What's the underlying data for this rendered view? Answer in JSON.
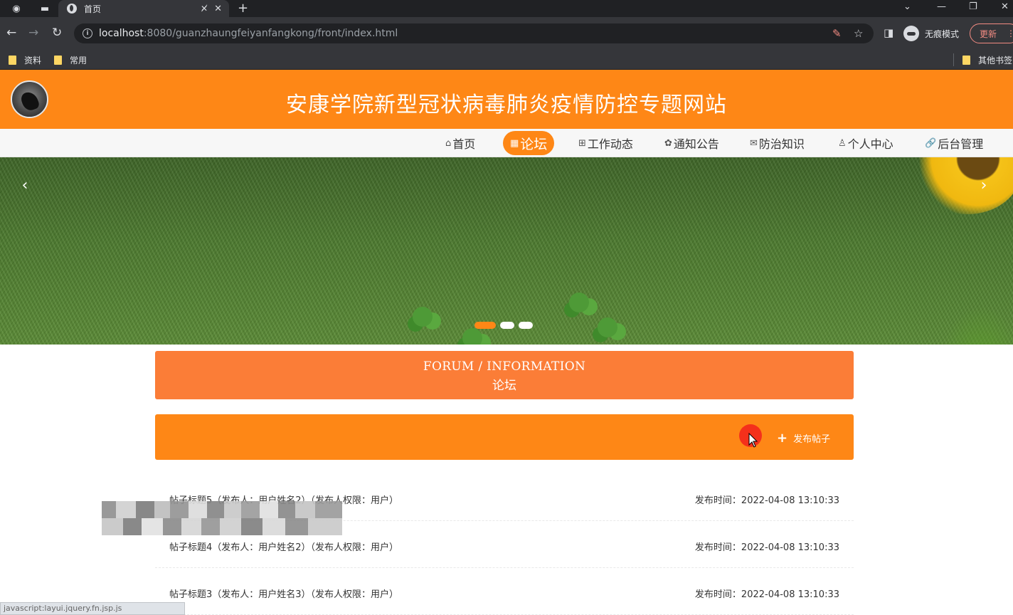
{
  "browser": {
    "tab_title": "首页",
    "url_host": "localhost",
    "url_rest": ":8080/guanzhaungfeiyanfangkong/front/index.html",
    "incognito_label": "无痕模式",
    "update_label": "更新",
    "bookmarks": [
      "资料",
      "常用"
    ],
    "other_bookmarks": "其他书签"
  },
  "site": {
    "title": "安康学院新型冠状病毒肺炎疫情防控专题网站",
    "nav": [
      {
        "icon": "⌂",
        "label": "首页"
      },
      {
        "icon": "▦",
        "label": "论坛"
      },
      {
        "icon": "⊞",
        "label": "工作动态"
      },
      {
        "icon": "✿",
        "label": "通知公告"
      },
      {
        "icon": "✉",
        "label": "防治知识"
      },
      {
        "icon": "♙",
        "label": "个人中心"
      },
      {
        "icon": "🔗",
        "label": "后台管理"
      }
    ],
    "active_nav": "论坛"
  },
  "section": {
    "title_en": "FORUM / INFORMATION",
    "title_zh": "论坛"
  },
  "toolbar": {
    "publish_label": "发布帖子"
  },
  "posts": [
    {
      "title": "帖子标题5（发布人：用户姓名2）（发布人权限：用户）",
      "time": "发布时间：2022-04-08 13:10:33"
    },
    {
      "title": "帖子标题4（发布人：用户姓名2）（发布人权限：用户）",
      "time": "发布时间：2022-04-08 13:10:33"
    },
    {
      "title": "帖子标题3（发布人：用户姓名3）（发布人权限：用户）",
      "time": "发布时间：2022-04-08 13:10:33"
    }
  ],
  "status_bar": "javascript:layui.jquery.fn.jsp.js",
  "banner": {
    "slide_count": 3,
    "active_slide": 1
  },
  "colors": {
    "primary": "#fe8716",
    "section_head": "#fb7d37",
    "click_mark": "#f4301b"
  }
}
